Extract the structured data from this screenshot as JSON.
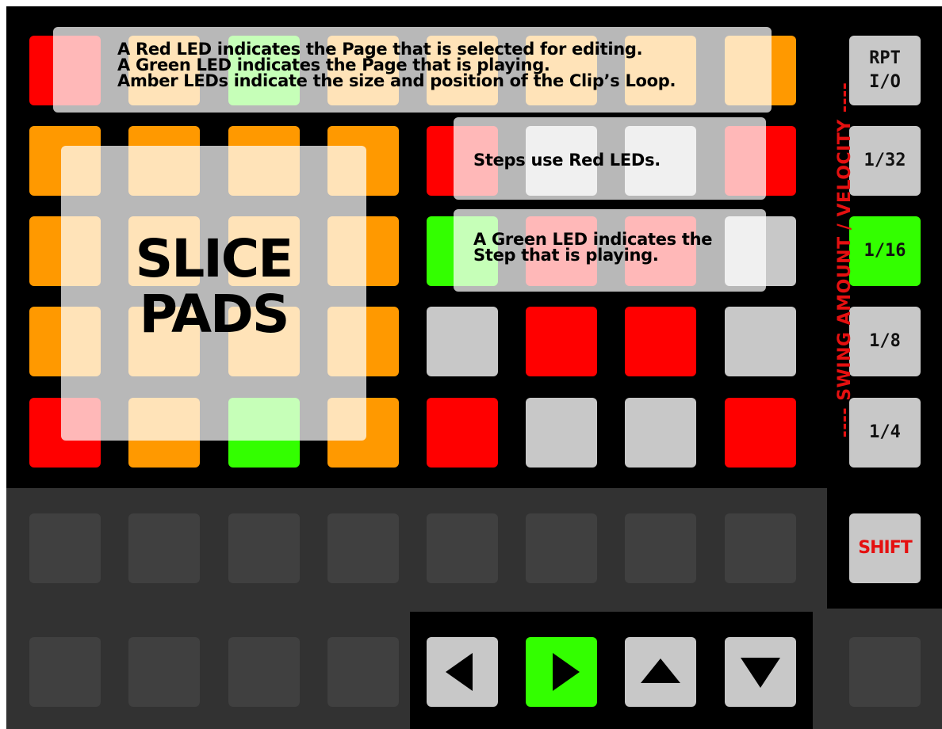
{
  "colors": {
    "red": "#ff0000",
    "amber": "#ff9900",
    "green": "#33ff00",
    "grey": "#c8c8c8",
    "dark": "#404040",
    "swing_text": "#e51010"
  },
  "grid": {
    "rows": [
      [
        "red",
        "amber",
        "green",
        "amber",
        "amber",
        "amber",
        "amber",
        "amber"
      ],
      [
        "amber",
        "amber",
        "amber",
        "amber",
        "red",
        "grey",
        "grey",
        "red"
      ],
      [
        "amber",
        "amber",
        "amber",
        "amber",
        "green",
        "red",
        "red",
        "grey"
      ],
      [
        "amber",
        "amber",
        "amber",
        "amber",
        "grey",
        "red",
        "red",
        "grey"
      ],
      [
        "red",
        "amber",
        "green",
        "amber",
        "red",
        "grey",
        "grey",
        "red"
      ]
    ]
  },
  "overlays": {
    "page_info": {
      "line1": "A Red LED indicates the Page that is selected for editing.",
      "line2": "A Green LED indicates the Page that is playing.",
      "line3": "Amber LEDs indicate the size and position of the Clip’s Loop."
    },
    "steps_info": "Steps use Red LEDs.",
    "playing_step_info": {
      "line1": "A Green LED indicates the",
      "line2": "Step that is playing."
    },
    "slice_pads": {
      "line1": "SLICE",
      "line2": "PADS"
    }
  },
  "side_buttons": [
    {
      "line1": "RPT",
      "line2": "I/O",
      "color": "grey"
    },
    {
      "line1": "1/32",
      "line2": "",
      "color": "grey"
    },
    {
      "line1": "1/16",
      "line2": "",
      "color": "green"
    },
    {
      "line1": "1/8",
      "line2": "",
      "color": "grey"
    },
    {
      "line1": "1/4",
      "line2": "",
      "color": "grey"
    }
  ],
  "swing_label": "---- SWING AMOUNT / VELOCITY ----",
  "shift_label": "SHIFT",
  "nav_buttons": [
    {
      "icon": "arrow-left-icon",
      "color": "grey"
    },
    {
      "icon": "arrow-right-icon",
      "color": "green"
    },
    {
      "icon": "arrow-up-icon",
      "color": "grey"
    },
    {
      "icon": "arrow-down-icon",
      "color": "grey"
    }
  ]
}
